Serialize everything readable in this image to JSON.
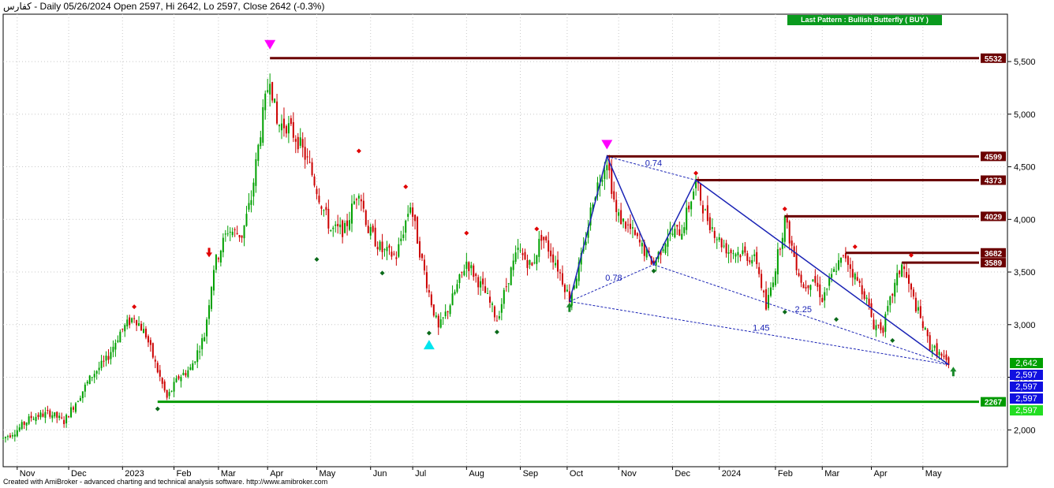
{
  "header": {
    "title": "كفارس - Daily 05/26/2024 Open 2597, Hi 2642, Lo 2597, Close 2642 (-0.3%)"
  },
  "pattern_badge": {
    "text": "Last Pattern : Bullish Butterfly ( BUY )"
  },
  "footer": {
    "text": "Created with AmiBroker - advanced charting and technical analysis software. http://www.amibroker.com"
  },
  "colors": {
    "up": "#00a000",
    "down": "#cc0000",
    "resistance": "#6b0000",
    "support": "#009900",
    "pattern": "#1a23b5",
    "peak_marker": "#ff00ff",
    "trough_marker": "#00e5ee",
    "badge": "#0a9a1e"
  },
  "chart_data": {
    "type": "candlestick",
    "title": "كفارس - Daily 05/26/2024 Open 2597, Hi 2642, Lo 2597, Close 2642 (-0.3%)",
    "ylim": [
      1650,
      5950
    ],
    "y_ticks": [
      2000,
      2500,
      3000,
      3500,
      4000,
      4500,
      5000,
      5500
    ],
    "y_tick_labels": [
      "2,000",
      "2,500",
      "3,000",
      "3,500",
      "4,000",
      "4,500",
      "5,000",
      "5,500"
    ],
    "x_ticks": [
      {
        "x": 6,
        "label": "Nov"
      },
      {
        "x": 28,
        "label": "Dec"
      },
      {
        "x": 51,
        "label": "2023"
      },
      {
        "x": 73,
        "label": "Feb"
      },
      {
        "x": 92,
        "label": "Mar"
      },
      {
        "x": 113,
        "label": "Apr"
      },
      {
        "x": 134,
        "label": "May"
      },
      {
        "x": 157,
        "label": "Jun"
      },
      {
        "x": 175,
        "label": "Jul"
      },
      {
        "x": 198,
        "label": "Aug"
      },
      {
        "x": 221,
        "label": "Sep"
      },
      {
        "x": 241,
        "label": "Oct"
      },
      {
        "x": 263,
        "label": "Nov"
      },
      {
        "x": 286,
        "label": "Dec"
      },
      {
        "x": 306,
        "label": "2024"
      },
      {
        "x": 330,
        "label": "Feb"
      },
      {
        "x": 350,
        "label": "Mar"
      },
      {
        "x": 371,
        "label": "Apr"
      },
      {
        "x": 393,
        "label": "May"
      }
    ],
    "x_range": [
      0,
      417
    ],
    "path": [
      [
        0,
        1920
      ],
      [
        6,
        2000
      ],
      [
        12,
        2120
      ],
      [
        20,
        2160
      ],
      [
        26,
        2080
      ],
      [
        32,
        2300
      ],
      [
        38,
        2520
      ],
      [
        44,
        2660
      ],
      [
        50,
        2930
      ],
      [
        56,
        3080
      ],
      [
        61,
        2900
      ],
      [
        66,
        2560
      ],
      [
        70,
        2300
      ],
      [
        75,
        2500
      ],
      [
        80,
        2580
      ],
      [
        86,
        2900
      ],
      [
        90,
        3550
      ],
      [
        96,
        3900
      ],
      [
        102,
        3850
      ],
      [
        106,
        4200
      ],
      [
        110,
        4850
      ],
      [
        114,
        5380
      ],
      [
        117,
        4900
      ],
      [
        121,
        4900
      ],
      [
        126,
        4750
      ],
      [
        131,
        4500
      ],
      [
        136,
        4150
      ],
      [
        140,
        3900
      ],
      [
        146,
        3900
      ],
      [
        152,
        4300
      ],
      [
        156,
        3900
      ],
      [
        162,
        3700
      ],
      [
        168,
        3650
      ],
      [
        174,
        4150
      ],
      [
        178,
        3700
      ],
      [
        182,
        3300
      ],
      [
        186,
        2950
      ],
      [
        192,
        3250
      ],
      [
        198,
        3600
      ],
      [
        202,
        3450
      ],
      [
        206,
        3300
      ],
      [
        211,
        3050
      ],
      [
        216,
        3450
      ],
      [
        220,
        3700
      ],
      [
        226,
        3550
      ],
      [
        230,
        3850
      ],
      [
        236,
        3600
      ],
      [
        242,
        3250
      ],
      [
        248,
        3700
      ],
      [
        252,
        4200
      ],
      [
        258,
        4580
      ],
      [
        262,
        4050
      ],
      [
        268,
        3900
      ],
      [
        274,
        3700
      ],
      [
        278,
        3580
      ],
      [
        284,
        3850
      ],
      [
        290,
        3900
      ],
      [
        296,
        4350
      ],
      [
        300,
        4050
      ],
      [
        306,
        3800
      ],
      [
        310,
        3700
      ],
      [
        316,
        3680
      ],
      [
        322,
        3600
      ],
      [
        326,
        3150
      ],
      [
        330,
        3550
      ],
      [
        334,
        4000
      ],
      [
        338,
        3650
      ],
      [
        342,
        3350
      ],
      [
        346,
        3450
      ],
      [
        350,
        3250
      ],
      [
        356,
        3550
      ],
      [
        360,
        3650
      ],
      [
        364,
        3450
      ],
      [
        368,
        3300
      ],
      [
        372,
        3000
      ],
      [
        376,
        2970
      ],
      [
        380,
        3300
      ],
      [
        384,
        3580
      ],
      [
        388,
        3300
      ],
      [
        392,
        3050
      ],
      [
        396,
        2800
      ],
      [
        400,
        2720
      ],
      [
        404,
        2597
      ]
    ],
    "price_levels": [
      {
        "value": 5532,
        "label": "5532",
        "x_start": 114,
        "kind": "resistance"
      },
      {
        "value": 4599,
        "label": "4599",
        "x_start": 258,
        "kind": "resistance"
      },
      {
        "value": 4373,
        "label": "4373",
        "x_start": 296,
        "kind": "resistance"
      },
      {
        "value": 4029,
        "label": "4029",
        "x_start": 334,
        "kind": "resistance"
      },
      {
        "value": 3682,
        "label": "3682",
        "x_start": 360,
        "kind": "resistance"
      },
      {
        "value": 3589,
        "label": "3589",
        "x_start": 384,
        "kind": "resistance"
      },
      {
        "value": 2267,
        "label": "2267",
        "x_start": 66,
        "kind": "support"
      }
    ],
    "axis_value_tags": [
      {
        "value": 2642,
        "label": "2,642",
        "color": "#00a000"
      },
      {
        "value": 2597,
        "label": "2,597",
        "color": "#1010e0"
      },
      {
        "value": 2597,
        "label": "2,597",
        "color": "#1010e0"
      },
      {
        "value": 2597,
        "label": "2,597",
        "color": "#1010e0"
      },
      {
        "value": 2597,
        "label": "2,597",
        "color": "#22dd22"
      }
    ],
    "pattern": {
      "name": "Bullish Butterfly",
      "points": [
        [
          242,
          3220
        ],
        [
          258,
          4599
        ],
        [
          278,
          3570
        ],
        [
          296,
          4373
        ],
        [
          404,
          2620
        ]
      ],
      "ratios": [
        {
          "from": 0,
          "to": 2,
          "label": "0.78"
        },
        {
          "from": 1,
          "to": 3,
          "label": "0.74"
        },
        {
          "from": 2,
          "to": 4,
          "label": "2.25"
        },
        {
          "from": 0,
          "to": 4,
          "label": "1.45"
        }
      ]
    },
    "peak_markers": [
      {
        "x": 114,
        "value": 5600
      },
      {
        "x": 258,
        "value": 4650
      }
    ],
    "trough_markers": [
      {
        "x": 182,
        "value": 2870
      }
    ],
    "pivot_highs": [
      [
        56,
        3170
      ],
      [
        152,
        4650
      ],
      [
        172,
        4310
      ],
      [
        198,
        3870
      ],
      [
        228,
        3910
      ],
      [
        296,
        4440
      ],
      [
        334,
        4100
      ],
      [
        364,
        3740
      ],
      [
        388,
        3660
      ]
    ],
    "pivot_lows": [
      [
        66,
        2200
      ],
      [
        134,
        3620
      ],
      [
        162,
        3490
      ],
      [
        182,
        2920
      ],
      [
        211,
        2930
      ],
      [
        278,
        3510
      ],
      [
        334,
        3120
      ],
      [
        356,
        3050
      ],
      [
        380,
        2850
      ]
    ],
    "buy_arrows": [
      [
        242,
        3150
      ],
      [
        406,
        2540
      ]
    ],
    "sell_arrows": [
      [
        88,
        3700
      ]
    ]
  }
}
